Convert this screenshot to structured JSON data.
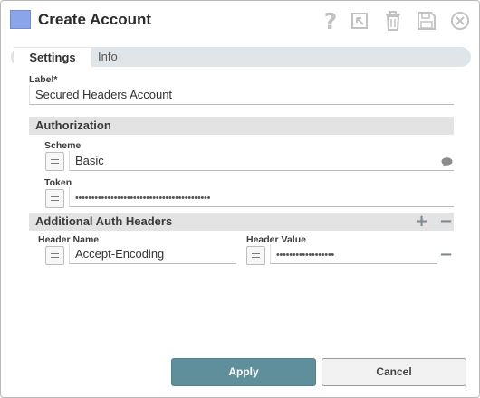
{
  "dialog": {
    "title": "Create Account",
    "toolbar": {
      "help_glyph": "?",
      "icons": [
        "help-icon",
        "export-icon",
        "delete-icon",
        "save-icon",
        "close-icon"
      ]
    }
  },
  "tabs": [
    {
      "label": "Settings",
      "active": true
    },
    {
      "label": "Info",
      "active": false
    }
  ],
  "form": {
    "label_field": {
      "label": "Label*",
      "value": "Secured Headers Account"
    },
    "authorization": {
      "title": "Authorization",
      "scheme": {
        "label": "Scheme",
        "value": "Basic"
      },
      "token": {
        "label": "Token",
        "value": "••••••••••••••••••••••••••••••••••••••••••"
      }
    },
    "additional_headers": {
      "title": "Additional Auth Headers",
      "add_glyph": "+",
      "remove_glyph": "−",
      "columns": {
        "name": "Header Name",
        "value": "Header Value"
      },
      "rows": [
        {
          "name": "Accept-Encoding",
          "value": "••••••••••••••••••"
        }
      ]
    }
  },
  "buttons": {
    "apply": "Apply",
    "cancel": "Cancel"
  },
  "colors": {
    "accent": "#5f8f9a",
    "header_icon": "#8aa6e8",
    "section_bg": "#e3e3e3",
    "tab_bar": "#dfe5e9"
  }
}
